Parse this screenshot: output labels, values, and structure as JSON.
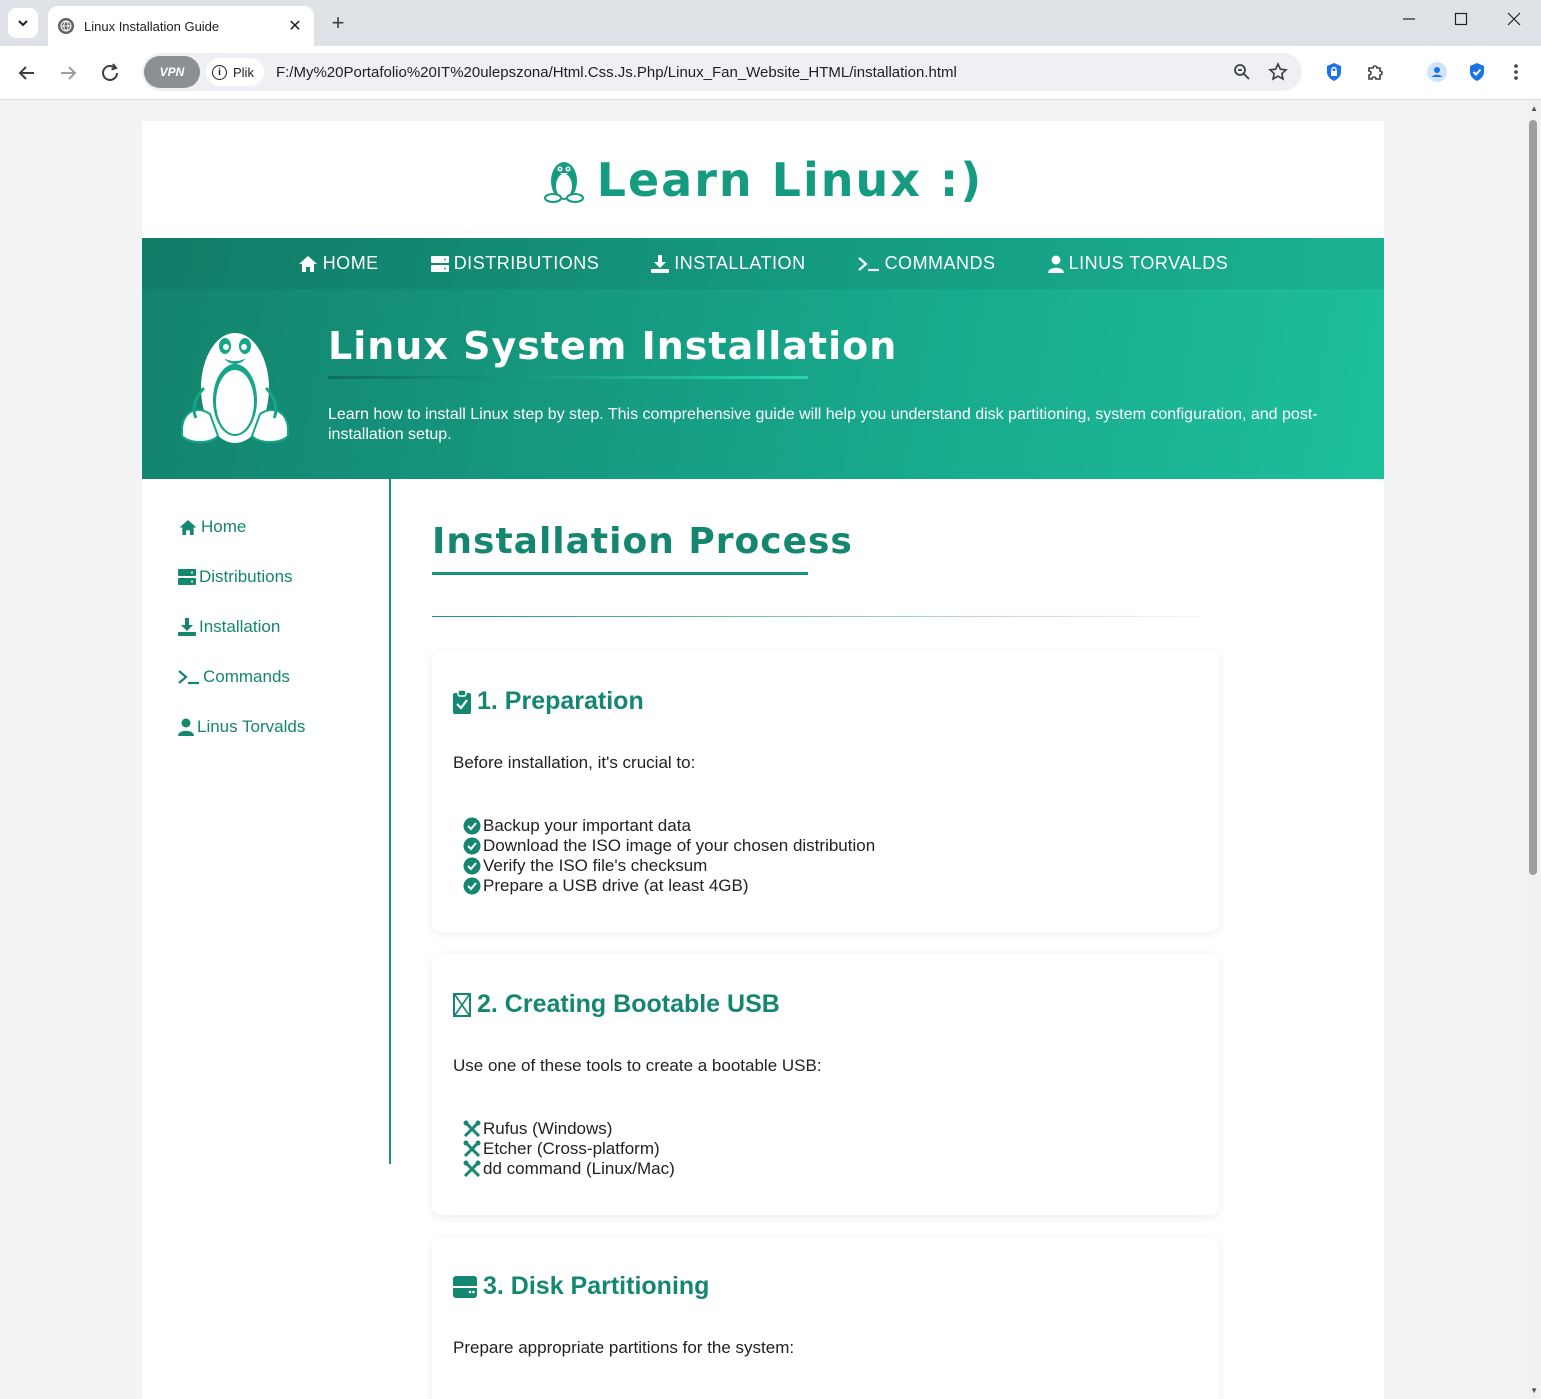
{
  "browser": {
    "tab_title": "Linux Installation Guide",
    "vpn_label": "VPN",
    "site_chip_label": "Plik",
    "url": "F:/My%20Portafolio%20IT%20ulepszona/Html.Css.Js.Php/Linux_Fan_Website_HTML/installation.html"
  },
  "site": {
    "logo_text": "Learn Linux :)",
    "nav": [
      {
        "label": "HOME",
        "icon": "home-icon"
      },
      {
        "label": "DISTRIBUTIONS",
        "icon": "server-icon"
      },
      {
        "label": "INSTALLATION",
        "icon": "download-icon"
      },
      {
        "label": "COMMANDS",
        "icon": "terminal-icon"
      },
      {
        "label": "LINUS TORVALDS",
        "icon": "user-icon"
      }
    ]
  },
  "hero": {
    "title": "Linux System Installation",
    "description": "Learn how to install Linux step by step. This comprehensive guide will help you understand disk partitioning, system configuration, and post-installation setup."
  },
  "sidebar": {
    "items": [
      {
        "label": "Home",
        "icon": "home-icon"
      },
      {
        "label": "Distributions",
        "icon": "server-icon"
      },
      {
        "label": "Installation",
        "icon": "download-icon"
      },
      {
        "label": "Commands",
        "icon": "terminal-icon"
      },
      {
        "label": "Linus Torvalds",
        "icon": "user-icon"
      }
    ]
  },
  "content": {
    "section_title": "Installation Process",
    "cards": [
      {
        "title": "1. Preparation",
        "icon": "clipboard-check-icon",
        "intro": "Before installation, it's crucial to:",
        "items": [
          "Backup your important data",
          "Download the ISO image of your chosen distribution",
          "Verify the ISO file's checksum",
          "Prepare a USB drive (at least 4GB)"
        ]
      },
      {
        "title": "2. Creating Bootable USB",
        "icon": "missing-glyph-icon",
        "intro": "Use one of these tools to create a bootable USB:",
        "items": [
          "Rufus (Windows)",
          "Etcher (Cross-platform)",
          "dd command (Linux/Mac)"
        ]
      },
      {
        "title": "3. Disk Partitioning",
        "icon": "hdd-icon",
        "intro": "Prepare appropriate partitions for the system:"
      }
    ]
  },
  "colors": {
    "accent": "#15866f",
    "hero_start": "#13836d",
    "hero_end": "#1dbf9b"
  }
}
